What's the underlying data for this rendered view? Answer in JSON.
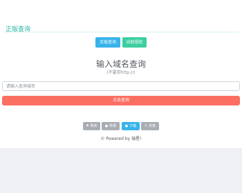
{
  "header": {
    "title": "正版查询"
  },
  "top_buttons": {
    "genuine_query": "正版查询",
    "auto_authorize": "自助授权"
  },
  "main": {
    "heading": "输入域名查询",
    "subheading": "(不要带http://)",
    "input_placeholder": "请输入查询域名",
    "input_value": "",
    "submit_label": "点击查询"
  },
  "footer_buttons": [
    {
      "label": "购买",
      "icon": "cart-icon"
    },
    {
      "label": "举报",
      "icon": "report-icon"
    },
    {
      "label": "下载",
      "icon": "user-icon"
    },
    {
      "label": "安装",
      "icon": "wrench-icon"
    }
  ],
  "powered_by": "© Powered by 瑞星!",
  "colors": {
    "accent_teal": "#2bb5a8",
    "blue": "#37b3ea",
    "green": "#3ccea1",
    "red": "#fb6e62",
    "gray_button": "#a7adb3",
    "page_bg": "#eef0f4"
  }
}
